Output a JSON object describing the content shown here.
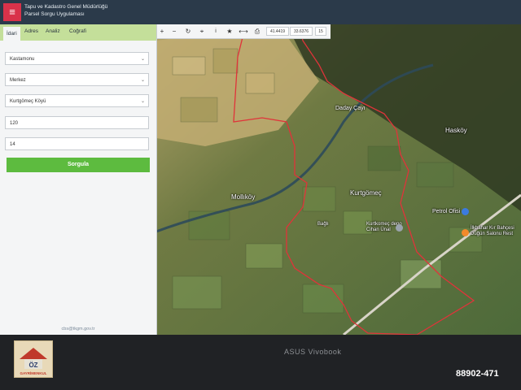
{
  "app": {
    "title_line1": "Tapu ve Kadastro Genel Müdürlüğü",
    "title_line2": "Parsel Sorgu Uygulaması"
  },
  "colors": {
    "accent_red": "#d9324a",
    "topbar": "#2b3a4a",
    "tab_bar": "#c4df9a",
    "query_green": "#5dbb3f",
    "parcel_border": "#e0333a"
  },
  "tabs": [
    {
      "label": "İdari",
      "active": true
    },
    {
      "label": "Adres",
      "active": false
    },
    {
      "label": "Analiz",
      "active": false
    },
    {
      "label": "Coğrafi",
      "active": false
    }
  ],
  "form": {
    "province": "Kastamonu",
    "district": "Merkez",
    "village": "Kurtgömeç Köyü",
    "block": "120",
    "parcel": "14",
    "query_label": "Sorgula"
  },
  "footer_email": "cbs@tkgm.gov.tr",
  "toolbar": {
    "icons": [
      "zoom-in-icon",
      "zoom-out-icon",
      "refresh-icon",
      "locate-icon",
      "info-icon",
      "star-icon",
      "measure-icon",
      "print-icon"
    ],
    "lat": "41.4419",
    "lon": "33.6376",
    "zoom": "15"
  },
  "map_labels": {
    "dadaycayi": "Daday Çayı",
    "haskoy": "Hasköy",
    "mollikoy": "Mollıköy",
    "kurtgomec": "Kurtgömeç",
    "petrol": "Petrol Ofisi",
    "ilkbahar": "İlkbahar Kır Bahçesi Düğün Salonu Rest",
    "depo": "Kurtkomeç depo Cihan Ünal",
    "pin_label": "Bağlı"
  },
  "screen_brand": "ASUS Vivobook",
  "logo": {
    "line1": "ÖZ",
    "line2": "GAYRİMENKUL"
  },
  "listing_id": "88902-471"
}
